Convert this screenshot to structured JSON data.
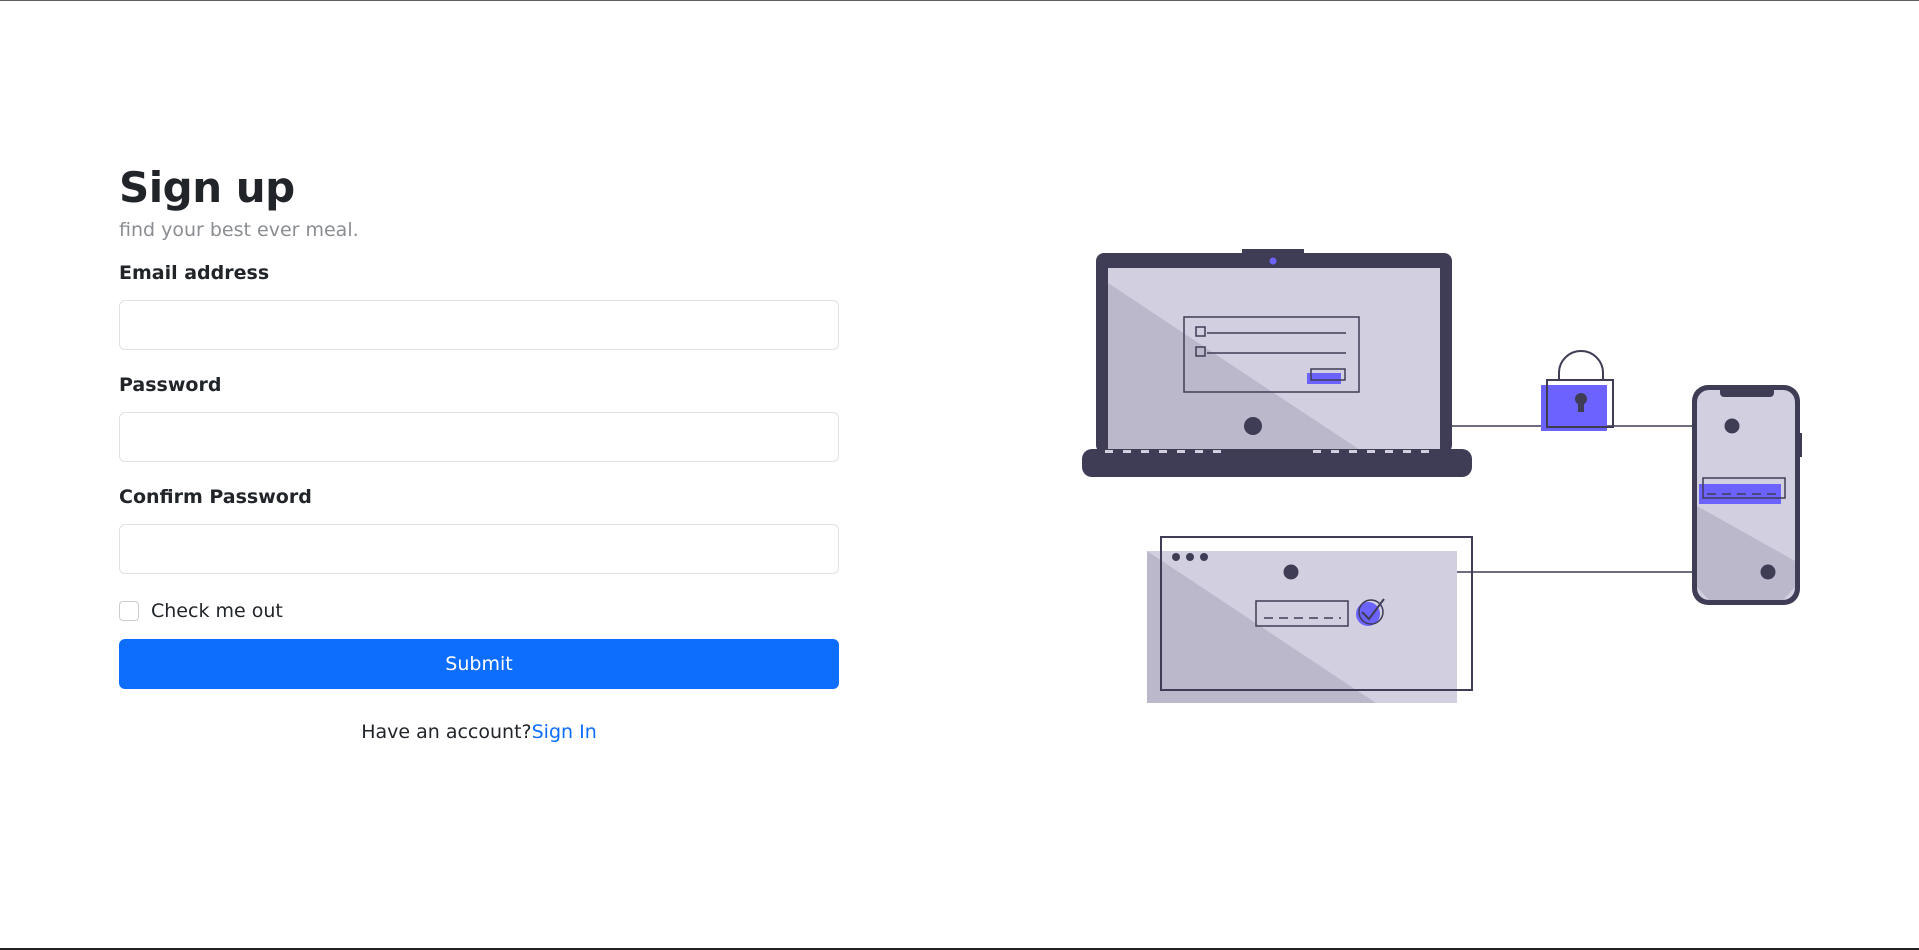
{
  "heading": "Sign up",
  "subtitle": "find your best ever meal.",
  "fields": {
    "email": {
      "label": "Email address",
      "value": "",
      "placeholder": ""
    },
    "password": {
      "label": "Password",
      "value": "",
      "placeholder": ""
    },
    "confirm": {
      "label": "Confirm Password",
      "value": "",
      "placeholder": ""
    }
  },
  "checkbox": {
    "label": "Check me out",
    "checked": false
  },
  "submit_label": "Submit",
  "signin": {
    "prompt": "Have an account?",
    "link_label": "Sign In"
  },
  "illustration": {
    "icons": [
      "laptop-icon",
      "lock-icon",
      "smartphone-icon",
      "browser-window-icon",
      "checkmark-icon"
    ]
  },
  "colors": {
    "primary": "#0d6efd",
    "illustration_dark": "#3f3d56",
    "illustration_light": "#d1cfe0",
    "illustration_shade": "#bab8ca",
    "illustration_accent": "#6c63ff"
  }
}
